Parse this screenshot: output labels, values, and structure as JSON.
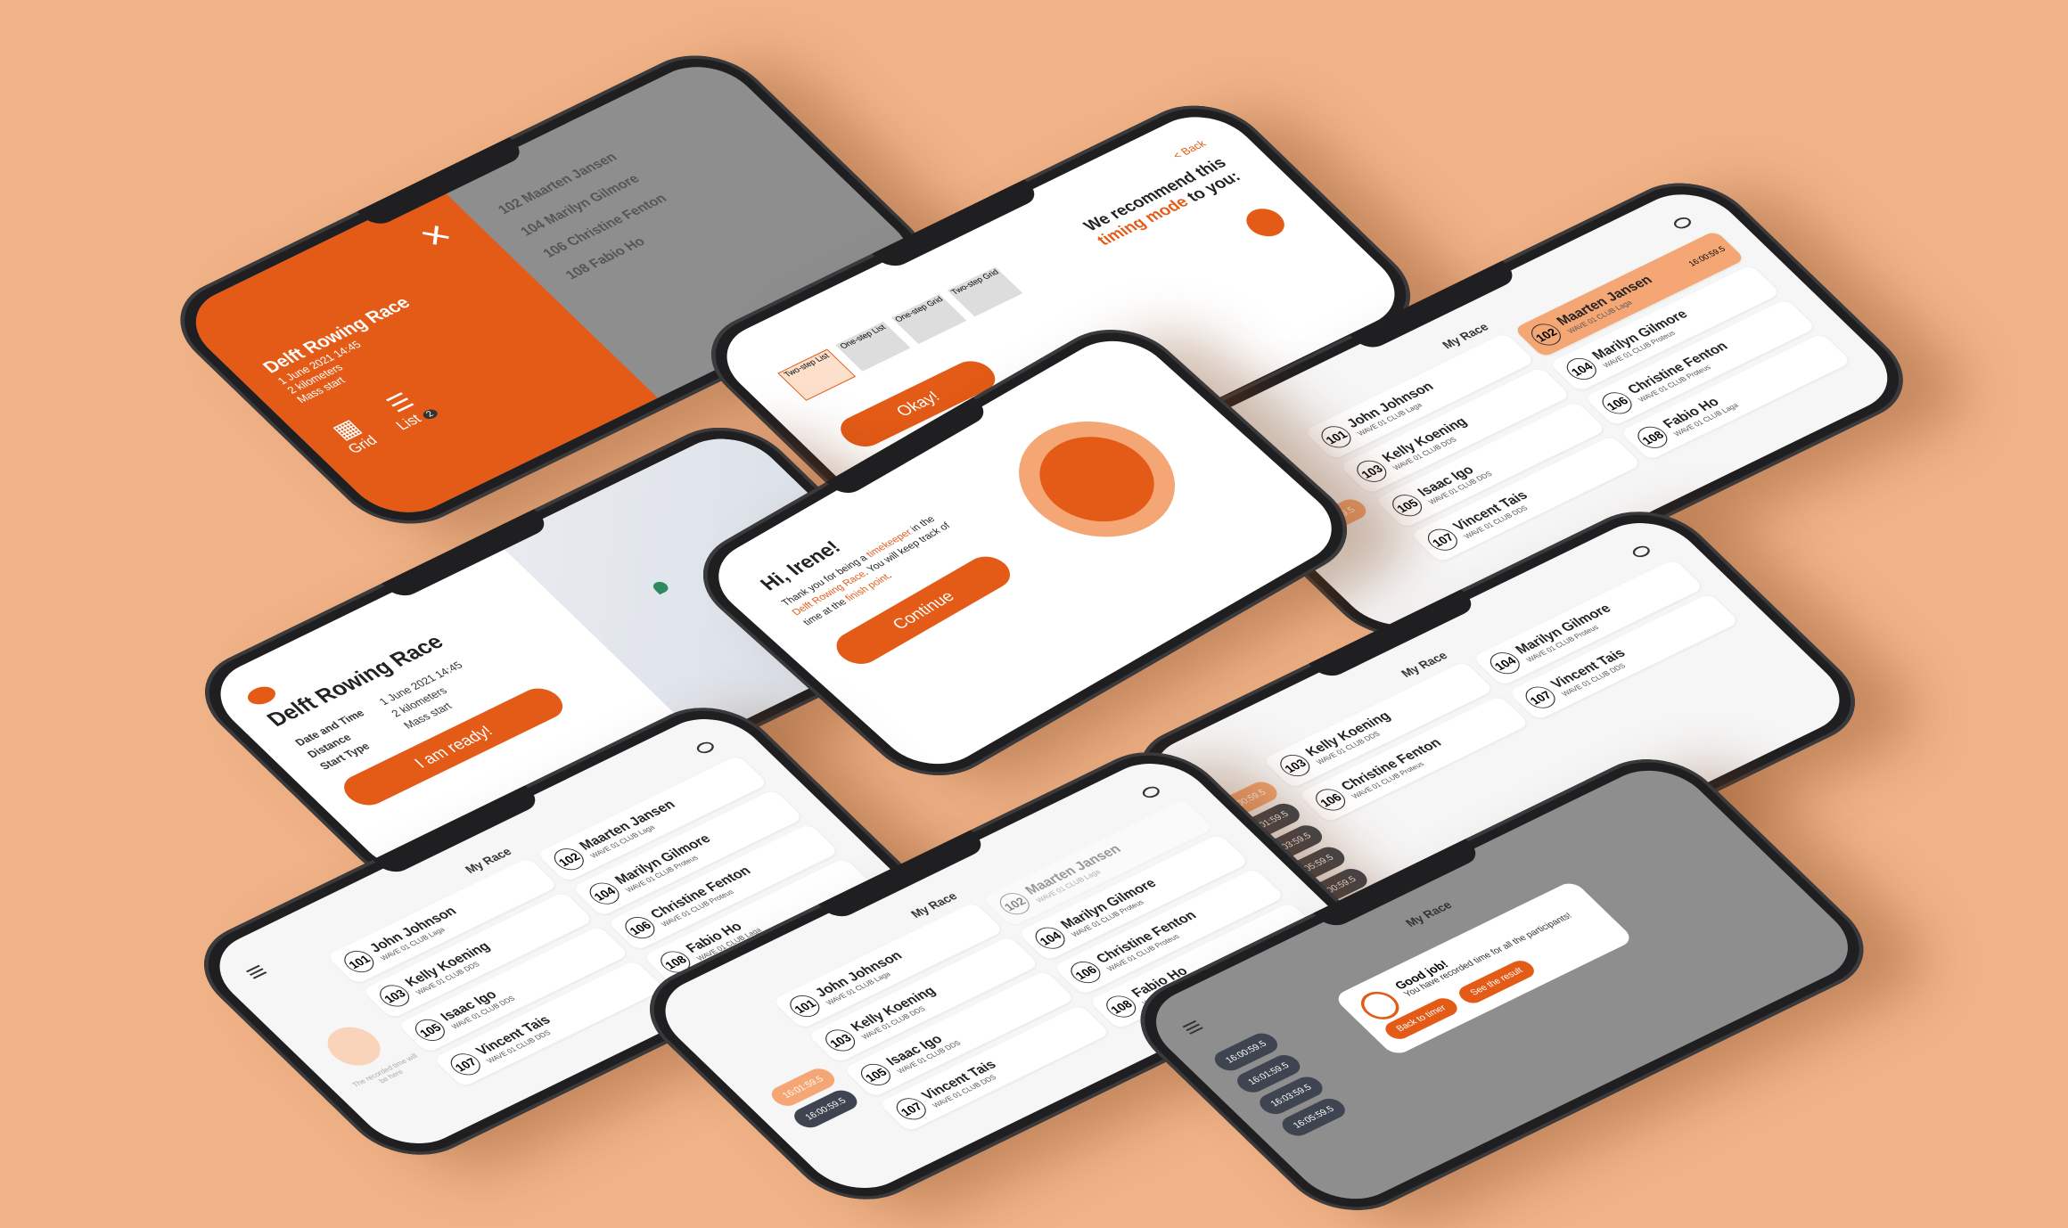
{
  "colors": {
    "background": "#f0b287",
    "accent": "#e35b17",
    "accent_light": "#f4a774",
    "pill_dark": "#3e4550"
  },
  "race": {
    "title": "Delft Rowing Race",
    "date_label": "Date and Time",
    "date_value": "1 June 2021 14:45",
    "distance_label": "Distance",
    "distance_value": "2 kilometers",
    "start_label": "Start Type",
    "start_value": "Mass start",
    "overlay_lines": [
      "1 June 2021 14:45",
      "2 kilometers",
      "Mass start"
    ],
    "ready_button": "I am ready!"
  },
  "menu_overlay": {
    "grid_label": "Grid",
    "list_label": "List",
    "list_badge": "2",
    "close_icon": "close-icon"
  },
  "mode": {
    "back": "< Back",
    "line1": "We recommend this",
    "line2_accent": "timing mode",
    "line2_rest": " to you:",
    "options": [
      "Two-step List",
      "One-step List",
      "One-step Grid",
      "Two-step Grid"
    ],
    "okay_button": "Okay!"
  },
  "welcome": {
    "greeting": "Hi, Irene!",
    "text1": "Thank you for being a ",
    "text_accent1": "timekeeper",
    "text2": " in the ",
    "text_accent2": "Delft Rowing Race",
    "text3": ". You will keep track of time at the ",
    "text_accent3": "finish point",
    "text4": ".",
    "continue_button": "Continue"
  },
  "my_race": {
    "title": "My Race"
  },
  "participants": [
    {
      "num": "101",
      "name": "John Johnson",
      "wave": "WAVE 01",
      "club": "CLUB Laga"
    },
    {
      "num": "102",
      "name": "Maarten Jansen",
      "wave": "WAVE 01",
      "club": "CLUB Laga"
    },
    {
      "num": "103",
      "name": "Kelly Koening",
      "wave": "WAVE 01",
      "club": "CLUB DDS"
    },
    {
      "num": "104",
      "name": "Marilyn Gilmore",
      "wave": "WAVE 01",
      "club": "CLUB Proteus"
    },
    {
      "num": "105",
      "name": "Isaac Igo",
      "wave": "WAVE 01",
      "club": "CLUB DDS"
    },
    {
      "num": "106",
      "name": "Christine Fenton",
      "wave": "WAVE 01",
      "club": "CLUB Proteus"
    },
    {
      "num": "107",
      "name": "Vincent Tais",
      "wave": "WAVE 01",
      "club": "CLUB DDS"
    },
    {
      "num": "108",
      "name": "Fabio Ho",
      "wave": "WAVE 01",
      "club": "CLUB Laga"
    }
  ],
  "times": {
    "highlight": "16:00:59.5",
    "list": [
      "16:00:59.5",
      "16:01:59.5",
      "16:03:59.5",
      "16:05:59.5",
      "16:00:59.5"
    ],
    "pair": [
      "16:01:59.5",
      "16:00:59.5"
    ]
  },
  "dialog": {
    "title": "Good job!",
    "text": "You have recorded time for all the participants!",
    "back_button": "Back to timer",
    "result_button": "See the result"
  },
  "empty": {
    "hint": "The recorded time will be here"
  }
}
